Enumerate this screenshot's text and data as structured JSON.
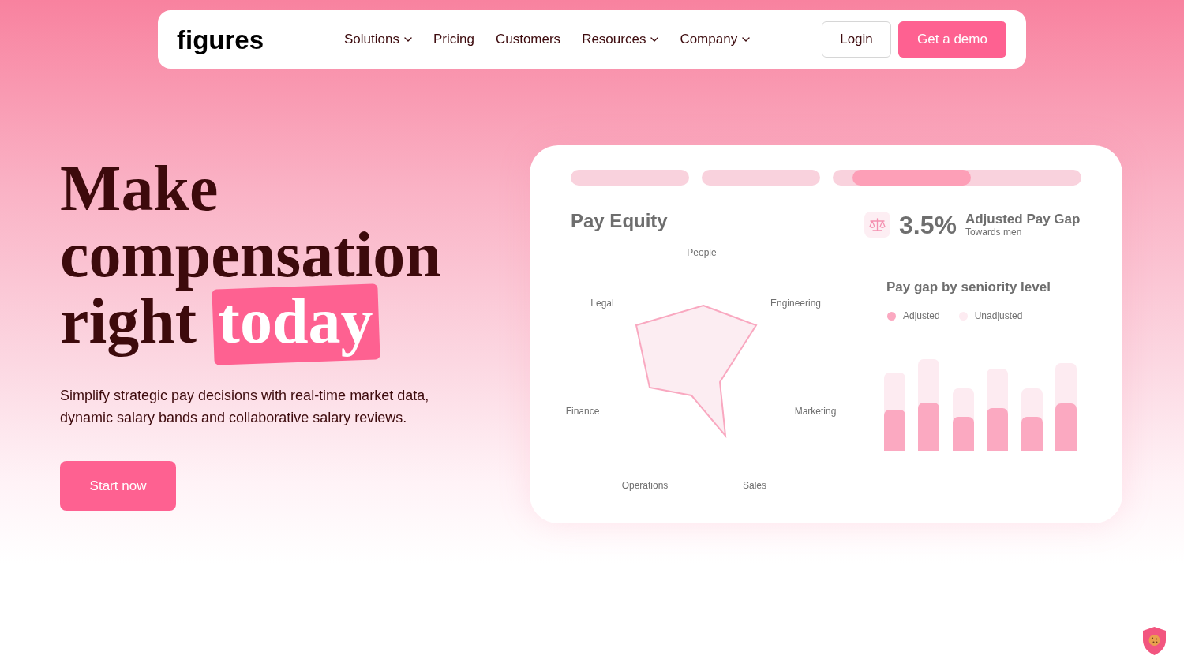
{
  "nav": {
    "logo": "figures",
    "links": [
      {
        "label": "Solutions",
        "has_menu": true
      },
      {
        "label": "Pricing",
        "has_menu": false
      },
      {
        "label": "Customers",
        "has_menu": false
      },
      {
        "label": "Resources",
        "has_menu": true
      },
      {
        "label": "Company",
        "has_menu": true
      }
    ],
    "login_button": "Login",
    "demo_button": "Get a demo"
  },
  "hero": {
    "heading": "Make compensation right",
    "heading_highlight": "today",
    "subtitle": "Simplify strategic pay decisions with real-time market data, dynamic salary bands and collaborative salary reviews.",
    "cta_button": "Start now"
  },
  "dashboard_card": {
    "indicators": [
      {
        "selected": false
      },
      {
        "selected": false
      },
      {
        "selected": true
      }
    ],
    "title": "Pay Equity",
    "gap_value": "3.5%",
    "gap_label": "Adjusted Pay Gap",
    "gap_note": "Towards men",
    "radar_labels": [
      "People",
      "Legal",
      "Engineering",
      "Finance",
      "Marketing",
      "Operations",
      "Sales"
    ],
    "seniority_title": "Pay gap by seniority level",
    "legend": [
      {
        "label": "Adjusted",
        "color": "#fba9c1"
      },
      {
        "label": "Unadjusted",
        "color": "#fdebf1"
      }
    ]
  }
}
